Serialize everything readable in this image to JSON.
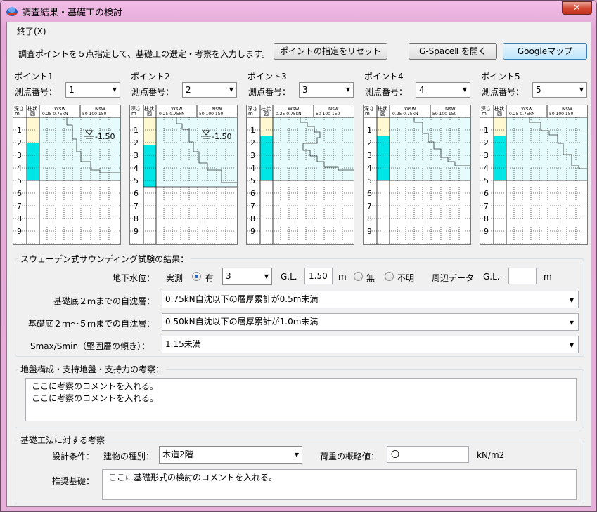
{
  "window": {
    "title": "調査結果・基礎工の検討",
    "close_label": "✕"
  },
  "menu": {
    "exit": "終了(X)"
  },
  "toolbar": {
    "instruction": "調査ポイントを５点指定して、基礎工の選定・考察を入力します。",
    "reset_button": "ポイントの指定をリセット",
    "gspace_button": "G-SpaceⅡ を開く",
    "google_button": "Googleマップ"
  },
  "points": [
    {
      "title": "ポイント1",
      "label": "測点番号：",
      "value": "1"
    },
    {
      "title": "ポイント2",
      "label": "測点番号：",
      "value": "2"
    },
    {
      "title": "ポイント3",
      "label": "測点番号：",
      "value": "3"
    },
    {
      "title": "ポイント4",
      "label": "測点番号：",
      "value": "4"
    },
    {
      "title": "ポイント5",
      "label": "測点番号：",
      "value": "5"
    }
  ],
  "log_chart": {
    "header_depth": "深さ",
    "header_depth_unit": "m",
    "header_column": "柱状",
    "header_column_sub": "図",
    "header_wsw": "Wsw",
    "header_wsw_ticks": "0.25  0.75kN",
    "header_nsw": "Nsw",
    "header_nsw_ticks": "50  100  150",
    "depths": [
      "1",
      "2",
      "3",
      "4",
      "5",
      "6",
      "7",
      "8",
      "9"
    ],
    "water_level_label": "-1.50"
  },
  "sounding": {
    "caption": "スウェーデン式サウンディング試験の結果：",
    "groundwater_label": "地下水位：",
    "measured_label": "実測",
    "yes_label": "有",
    "point_value": "3",
    "gl_label": "G.L.-",
    "gl_value": "1.50",
    "unit_m": "m",
    "none_label": "無",
    "unknown_label": "不明",
    "nearby_label": "周辺データ",
    "gl_label2": "G.L.-",
    "gl_value2": "",
    "unit_m2": "m",
    "row1_label": "基礎底２ｍまでの自沈層：",
    "row1_value": "0.75kN自沈以下の層厚累計が0.5m未満",
    "row2_label": "基礎底２ｍ～５ｍまでの自沈層：",
    "row2_value": "0.50kN自沈以下の層厚累計が1.0m未満",
    "row3_label": "Smax/Smin（堅固層の傾き）：",
    "row3_value": "1.15未満"
  },
  "ground": {
    "caption": "地盤構成・支持地盤・支持力の考察：",
    "line1": "ここに考察のコメントを入れる。",
    "line2": "ここに考察のコメントを入れる。"
  },
  "foundation": {
    "caption": "基礎工法に対する考察",
    "design_label": "設計条件：",
    "building_label": "建物の種別：",
    "building_value": "木造2階",
    "load_label": "荷重の概略値：",
    "load_value": "〇",
    "load_unit": "kN/m2",
    "recommend_label": "推奨基礎：",
    "recommend_value": "ここに基礎形式の検討のコメントを入れる。"
  },
  "colors": {
    "fill_sand": "#fff8d0",
    "fill_clay": "#00e6e6",
    "fill_chart": "#e6fbfb",
    "accent": "#3c7fb1"
  }
}
